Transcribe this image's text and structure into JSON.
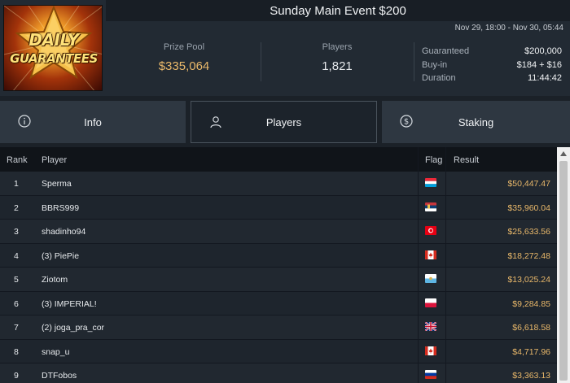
{
  "logo": {
    "line1": "DAILY",
    "line2": "GUARANTEES"
  },
  "title": "Sunday Main Event $200",
  "date_range": "Nov 29, 18:00 - Nov 30, 05:44",
  "stats": {
    "prize_pool_label": "Prize Pool",
    "prize_pool_value": "$335,064",
    "players_label": "Players",
    "players_value": "1,821"
  },
  "details": {
    "guaranteed_label": "Guaranteed",
    "guaranteed_value": "$200,000",
    "buyin_label": "Buy-in",
    "buyin_value": "$184 + $16",
    "duration_label": "Duration",
    "duration_value": "11:44:42"
  },
  "tabs": [
    {
      "label": "Info",
      "icon": "info-icon",
      "active": false
    },
    {
      "label": "Players",
      "icon": "user-icon",
      "active": true
    },
    {
      "label": "Staking",
      "icon": "dollar-icon",
      "active": false
    }
  ],
  "table": {
    "headers": {
      "rank": "Rank",
      "player": "Player",
      "flag": "Flag",
      "result": "Result"
    },
    "rows": [
      {
        "rank": "1",
        "player": "Sperma",
        "flag": "luxembourg-flag-icon",
        "result": "$50,447.47"
      },
      {
        "rank": "2",
        "player": "BBRS999",
        "flag": "serbia-flag-icon",
        "result": "$35,960.04"
      },
      {
        "rank": "3",
        "player": "shadinho94",
        "flag": "tunisia-flag-icon",
        "result": "$25,633.56"
      },
      {
        "rank": "4",
        "player": "(3) PiePie",
        "flag": "canada-flag-icon",
        "result": "$18,272.48"
      },
      {
        "rank": "5",
        "player": "Ziotom",
        "flag": "san-marino-flag-icon",
        "result": "$13,025.24"
      },
      {
        "rank": "6",
        "player": "(3) IMPERIAL!",
        "flag": "poland-flag-icon",
        "result": "$9,284.85"
      },
      {
        "rank": "7",
        "player": "(2) joga_pra_cor",
        "flag": "uk-flag-icon",
        "result": "$6,618.58"
      },
      {
        "rank": "8",
        "player": "snap_u",
        "flag": "canada-flag-icon",
        "result": "$4,717.96"
      },
      {
        "rank": "9",
        "player": "DTFobos",
        "flag": "russia-flag-icon",
        "result": "$3,363.13"
      }
    ]
  },
  "colors": {
    "accent_gold": "#e9b86a",
    "background": "#1b2128",
    "tab": "#2e3741"
  }
}
